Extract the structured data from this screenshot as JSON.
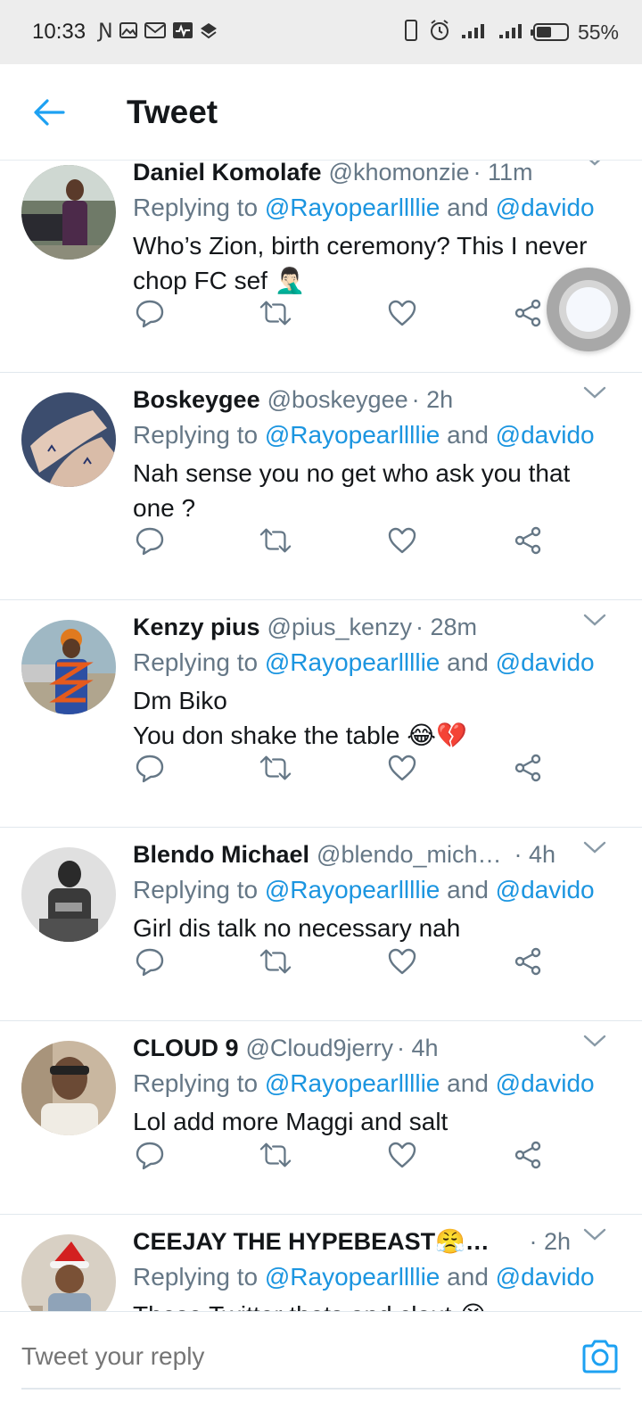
{
  "status_bar": {
    "time": "10:33",
    "battery": "55%",
    "battery_level": 0.55
  },
  "header": {
    "title": "Tweet"
  },
  "tweets": [
    {
      "name": "Daniel Komolafe",
      "handle": "@khomonzie",
      "time": "· 11m",
      "reply_prefix": "Replying to ",
      "mention_1": "@Rayopearllllie",
      "and": " and ",
      "mention_2": "@davido",
      "text_lines": [
        "Who’s Zion, birth ceremony? This I never",
        "chop FC sef 🤦🏻‍♂️"
      ]
    },
    {
      "name": "Boskeygee",
      "handle": "@boskeygee",
      "time": "· 2h",
      "reply_prefix": "Replying to ",
      "mention_1": "@Rayopearllllie",
      "and": " and ",
      "mention_2": "@davido",
      "text_lines": [
        "Nah sense you no get who ask you that",
        "one ?"
      ]
    },
    {
      "name": "Kenzy pius",
      "handle": "@pius_kenzy",
      "time": "· 28m",
      "reply_prefix": "Replying to ",
      "mention_1": "@Rayopearllllie",
      "and": " and ",
      "mention_2": "@davido",
      "text_lines": [
        "Dm Biko",
        "You don shake the table 😂💔"
      ]
    },
    {
      "name": "Blendo Michael",
      "handle": "@blendo_mich…",
      "time": "· 4h",
      "reply_prefix": "Replying to ",
      "mention_1": "@Rayopearllllie",
      "and": " and ",
      "mention_2": "@davido",
      "text_lines": [
        "Girl dis talk no necessary nah"
      ]
    },
    {
      "name": "CLOUD 9",
      "handle": "@Cloud9jerry",
      "time": "· 4h",
      "reply_prefix": "Replying to ",
      "mention_1": "@Rayopearllllie",
      "and": " and ",
      "mention_2": "@davido",
      "text_lines": [
        "Lol add more Maggi and salt"
      ]
    },
    {
      "name": "CEEJAY THE HYPEBEAST😤…",
      "handle": "",
      "time": "· 2h",
      "reply_prefix": "Replying to ",
      "mention_1": "@Rayopearllllie",
      "and": " and ",
      "mention_2": "@davido",
      "text_lines": [
        "These Twitter thots and clout 😭"
      ]
    }
  ],
  "composer": {
    "placeholder": "Tweet your reply"
  },
  "icons": {
    "back": "back-arrow-icon",
    "reply": "reply-icon",
    "retweet": "retweet-icon",
    "like": "heart-icon",
    "share": "share-icon",
    "more": "chevron-down-icon",
    "camera": "camera-icon"
  },
  "colors": {
    "accent": "#1b95e0",
    "secondary_text": "#657786",
    "primary_text": "#14171a",
    "divider": "#e1e8ed",
    "status_bar_bg": "#ededed"
  }
}
